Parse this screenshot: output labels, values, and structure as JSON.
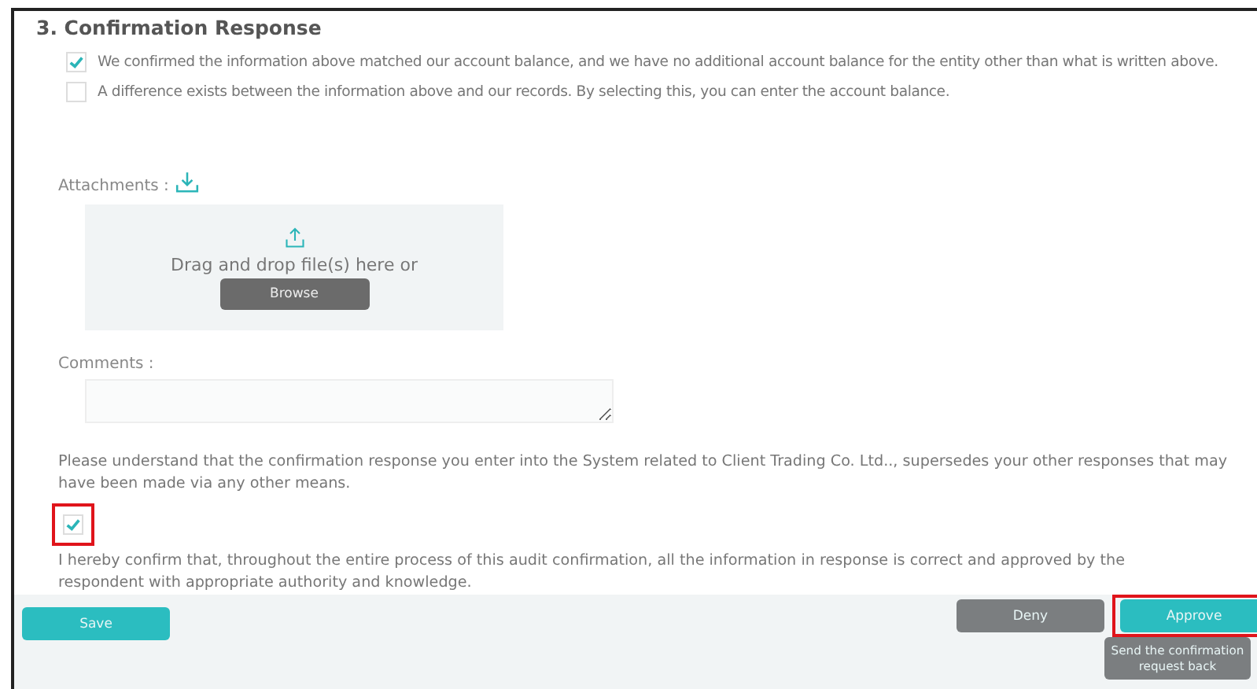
{
  "section": {
    "title": "3. Confirmation Response"
  },
  "options": [
    {
      "label": "We confirmed the information above matched our account balance, and we have no additional account balance for the entity other than what is written above.",
      "checked": true
    },
    {
      "label": "A difference exists between the information above and our records. By selecting this, you can enter the account balance.",
      "checked": false
    }
  ],
  "attachments": {
    "label": "Attachments :",
    "dropzone_text": "Drag and drop file(s) here or",
    "browse_button": "Browse"
  },
  "comments": {
    "label": "Comments :"
  },
  "notice": "Please understand that the confirmation response you enter into the System related to Client Trading Co. Ltd.., supersedes your other responses that may have been made via any other means.",
  "acknowledgement": {
    "checked": true,
    "highlighted": true,
    "label": "I hereby confirm that, throughout the entire process of this audit confirmation, all the information in response is correct and approved by the respondent with appropriate authority and knowledge."
  },
  "footer": {
    "left_buttons": [
      {
        "label": "Save",
        "kind": "primary",
        "highlighted": false
      }
    ],
    "right_buttons": [
      {
        "label": "Deny",
        "kind": "secondary",
        "highlighted": false
      },
      {
        "label": "Approve",
        "kind": "primary",
        "highlighted": true
      }
    ],
    "extra_buttons": [
      {
        "label": "Send the confirmation request back",
        "kind": "secondary",
        "highlighted": false
      }
    ]
  }
}
